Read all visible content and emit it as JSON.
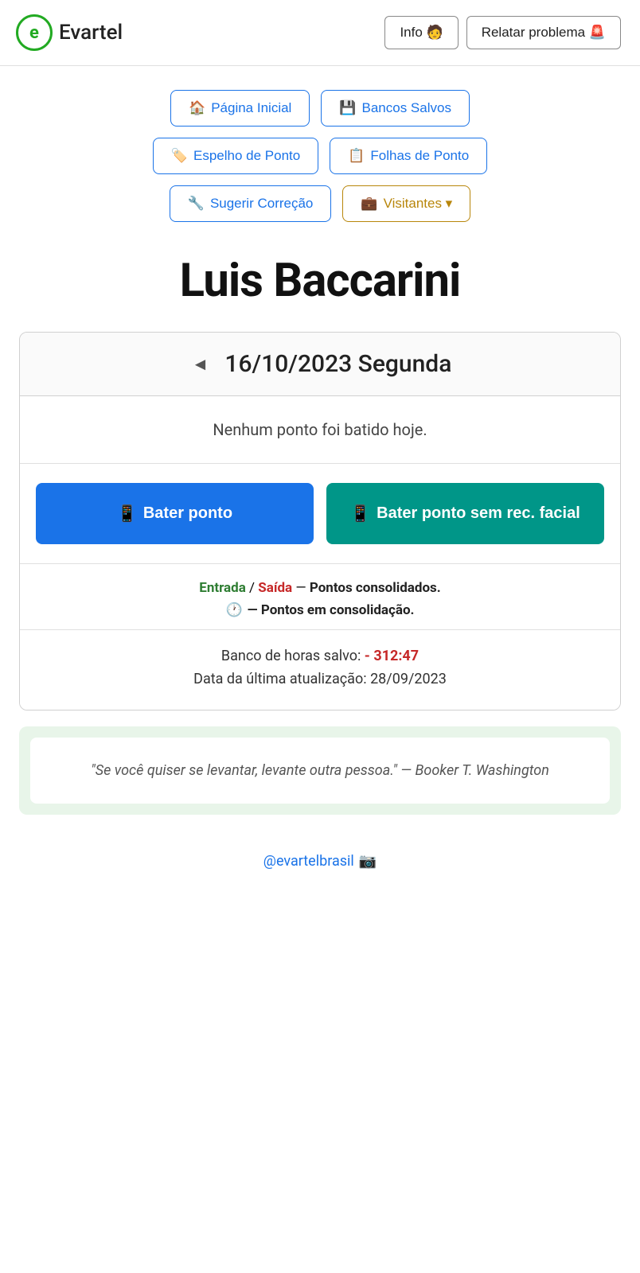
{
  "header": {
    "logo_letter": "e",
    "app_name": "Evartel",
    "info_btn": "Info 🧑",
    "report_btn": "Relatar problema 🚨"
  },
  "nav": {
    "row1": [
      {
        "label": "🏠 Página Inicial",
        "style": "blue"
      },
      {
        "label": "💾 Bancos Salvos",
        "style": "blue"
      }
    ],
    "row2": [
      {
        "label": "🏷️ Espelho de Ponto",
        "style": "blue"
      },
      {
        "label": "📋 Folhas de Ponto",
        "style": "blue"
      }
    ],
    "row3": [
      {
        "label": "🔧 Sugerir Correção",
        "style": "blue"
      },
      {
        "label": "💼 Visitantes ▾",
        "style": "brown"
      }
    ]
  },
  "user": {
    "name": "Luis Baccarini"
  },
  "date_card": {
    "arrow": "◄",
    "date": "16/10/2023 Segunda",
    "no_ponto_msg": "Nenhum ponto foi batido hoje.",
    "btn_bater": "📱 Bater ponto",
    "btn_bater_sem": "📱 Bater ponto sem rec. facial",
    "legend": {
      "entrada": "Entrada",
      "slash": " / ",
      "saida": "Saída",
      "dash": " — ",
      "consolidated": "Pontos consolidados.",
      "clock": "🕐",
      "consolidating": "— Pontos em consolidação."
    },
    "banco": {
      "label": "Banco de horas salvo: ",
      "value": "- 312:47",
      "update_label": "Data da última atualização: ",
      "update_date": "28/09/2023"
    }
  },
  "quote": {
    "text": "\"Se você quiser se levantar, levante outra pessoa.\"        — Booker T. Washington"
  },
  "footer": {
    "instagram_text": "@evartelbrasil 📷"
  }
}
